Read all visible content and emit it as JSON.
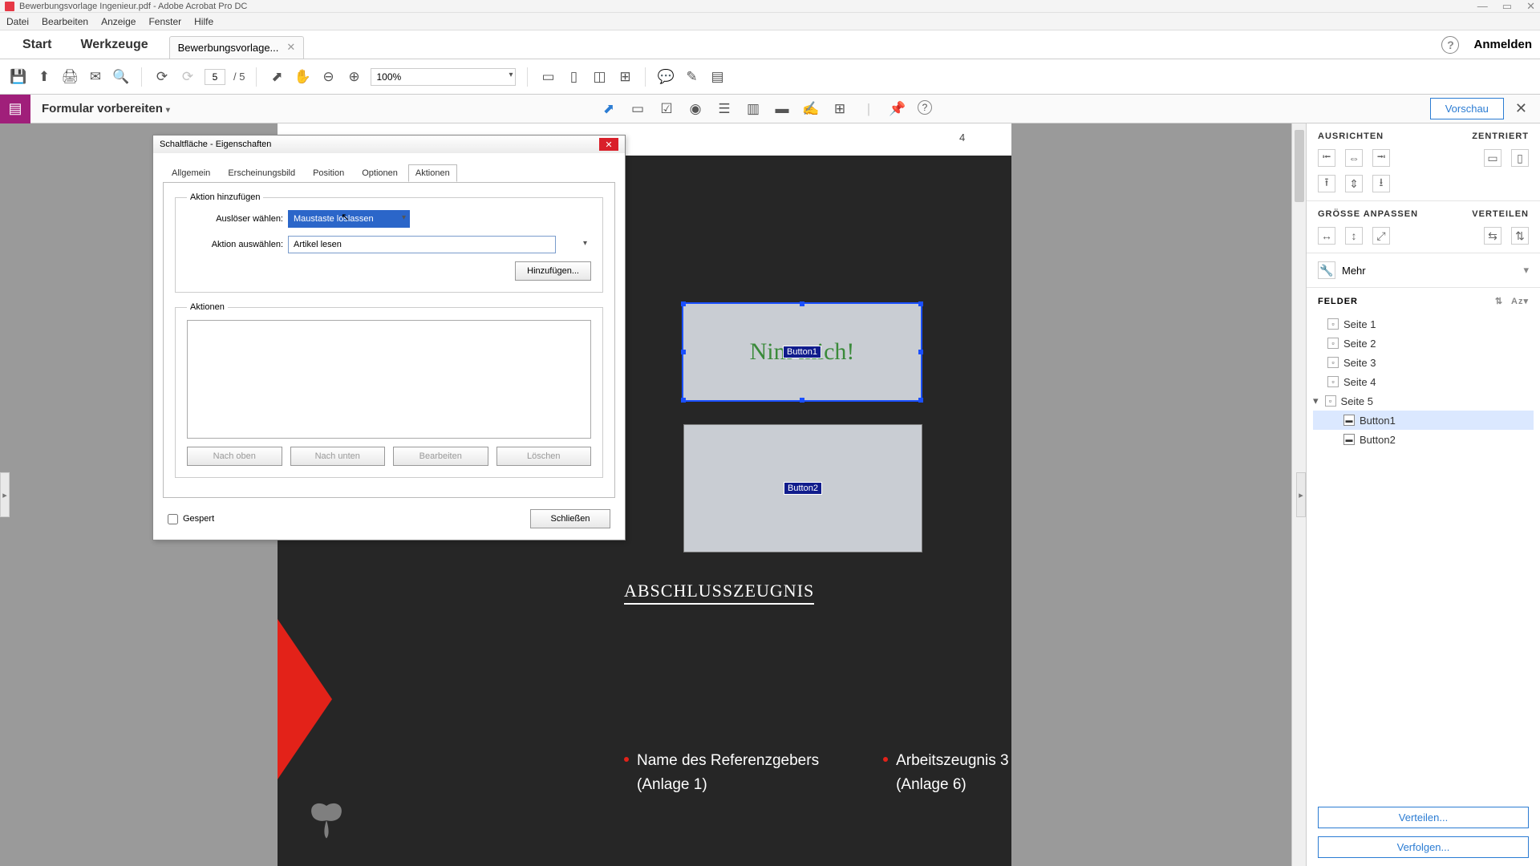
{
  "app": {
    "title": "Bewerbungsvorlage Ingenieur.pdf - Adobe Acrobat Pro DC"
  },
  "menu": {
    "items": [
      "Datei",
      "Bearbeiten",
      "Anzeige",
      "Fenster",
      "Hilfe"
    ]
  },
  "tabs": {
    "start": "Start",
    "tools": "Werkzeuge",
    "doc": "Bewerbungsvorlage...",
    "signin": "Anmelden"
  },
  "toolbar": {
    "page_current": "5",
    "page_total": "/ 5",
    "zoom": "100%"
  },
  "formbar": {
    "label": "Formular vorbereiten",
    "preview": "Vorschau"
  },
  "page": {
    "number_label": "4",
    "heading1": "ABSCHLUSSZEUGNIS",
    "ref_a_line1": "Name des Referenzgebers",
    "ref_a_line2": "(Anlage 1)",
    "ref_b_line1": "Arbeitszeugnis 3",
    "ref_b_line2": "(Anlage 6)",
    "button1_text": "Nim          mich!",
    "button1_name": "Button1",
    "button2_name": "Button2"
  },
  "dialog": {
    "title": "Schaltfläche - Eigenschaften",
    "tabs": [
      "Allgemein",
      "Erscheinungsbild",
      "Position",
      "Optionen",
      "Aktionen"
    ],
    "active_tab": 4,
    "fs_add": "Aktion hinzufügen",
    "lbl_trigger": "Auslöser wählen:",
    "val_trigger": "Maustaste loslassen",
    "lbl_action": "Aktion auswählen:",
    "val_action": "Artikel lesen",
    "btn_add": "Hinzufügen...",
    "fs_actions": "Aktionen",
    "btn_up": "Nach oben",
    "btn_down": "Nach unten",
    "btn_edit": "Bearbeiten",
    "btn_del": "Löschen",
    "chk_locked": "Gespert",
    "btn_close": "Schließen"
  },
  "right": {
    "sec1_a": "AUSRICHTEN",
    "sec1_b": "ZENTRIERT",
    "sec2_a": "GRÖSSE ANPASSEN",
    "sec2_b": "VERTEILEN",
    "mehr": "Mehr",
    "felder": "FELDER",
    "pages": [
      "Seite 1",
      "Seite 2",
      "Seite 3",
      "Seite 4",
      "Seite 5"
    ],
    "buttons": [
      "Button1",
      "Button2"
    ],
    "btn_dist": "Verteilen...",
    "btn_track": "Verfolgen..."
  }
}
